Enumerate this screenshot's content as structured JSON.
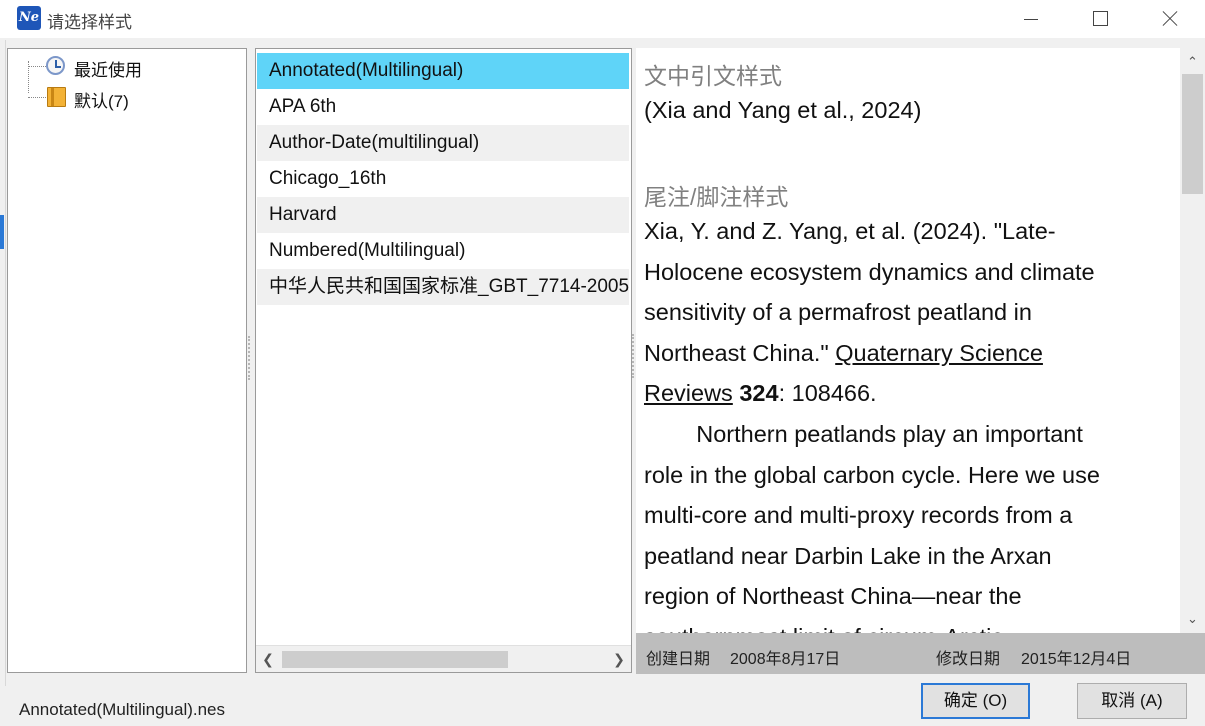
{
  "window": {
    "title": "请选择样式",
    "app_icon_text": "Ne"
  },
  "tree": {
    "items": [
      {
        "label": "最近使用",
        "icon": "clock-icon"
      },
      {
        "label": "默认(7)",
        "icon": "book-icon"
      }
    ]
  },
  "styles": {
    "items": [
      {
        "label": "Annotated(Multilingual)",
        "selected": true
      },
      {
        "label": "APA 6th"
      },
      {
        "label": "Author-Date(multilingual)"
      },
      {
        "label": "Chicago_16th"
      },
      {
        "label": "Harvard"
      },
      {
        "label": "Numbered(Multilingual)"
      },
      {
        "label": "中华人民共和国国家标准_GBT_7714-2005"
      }
    ]
  },
  "preview": {
    "in_text_heading": "文中引文样式",
    "in_text_citation": "(Xia and Yang et al., 2024)",
    "footnote_heading": "尾注/脚注样式",
    "ref_line1": "Xia, Y. and Z. Yang, et al. (2024). \"Late-",
    "ref_line2": "Holocene ecosystem dynamics and climate",
    "ref_line3": "sensitivity of a permafrost peatland in",
    "ref_line4_plain": "Northeast China.\" ",
    "ref_line4_journal": "Quaternary Science ",
    "ref_line5_journal": "Reviews",
    "ref_line5_volume": "324",
    "ref_line5_rest": ": 108466.",
    "abstract_lines": [
      "        Northern peatlands play an important",
      "role in the global carbon cycle. Here we use",
      "multi-core and multi-proxy records from a",
      "peatland near Darbin Lake in the Arxan",
      "region of Northeast China—near the",
      "southernmost limit of circum-Arctic"
    ]
  },
  "info": {
    "created_label": "创建日期",
    "created_value": "2008年8月17日",
    "modified_label": "修改日期",
    "modified_value": "2015年12月4日"
  },
  "status": {
    "file_name": "Annotated(Multilingual).nes"
  },
  "buttons": {
    "ok_label": "确定 (O)",
    "cancel_label": "取消 (A)"
  },
  "colors": {
    "selected_row": "#5fd4f8",
    "alt_row": "#f0f0f0",
    "info_bar": "#bdbdbd",
    "heading_gray": "#808080"
  }
}
